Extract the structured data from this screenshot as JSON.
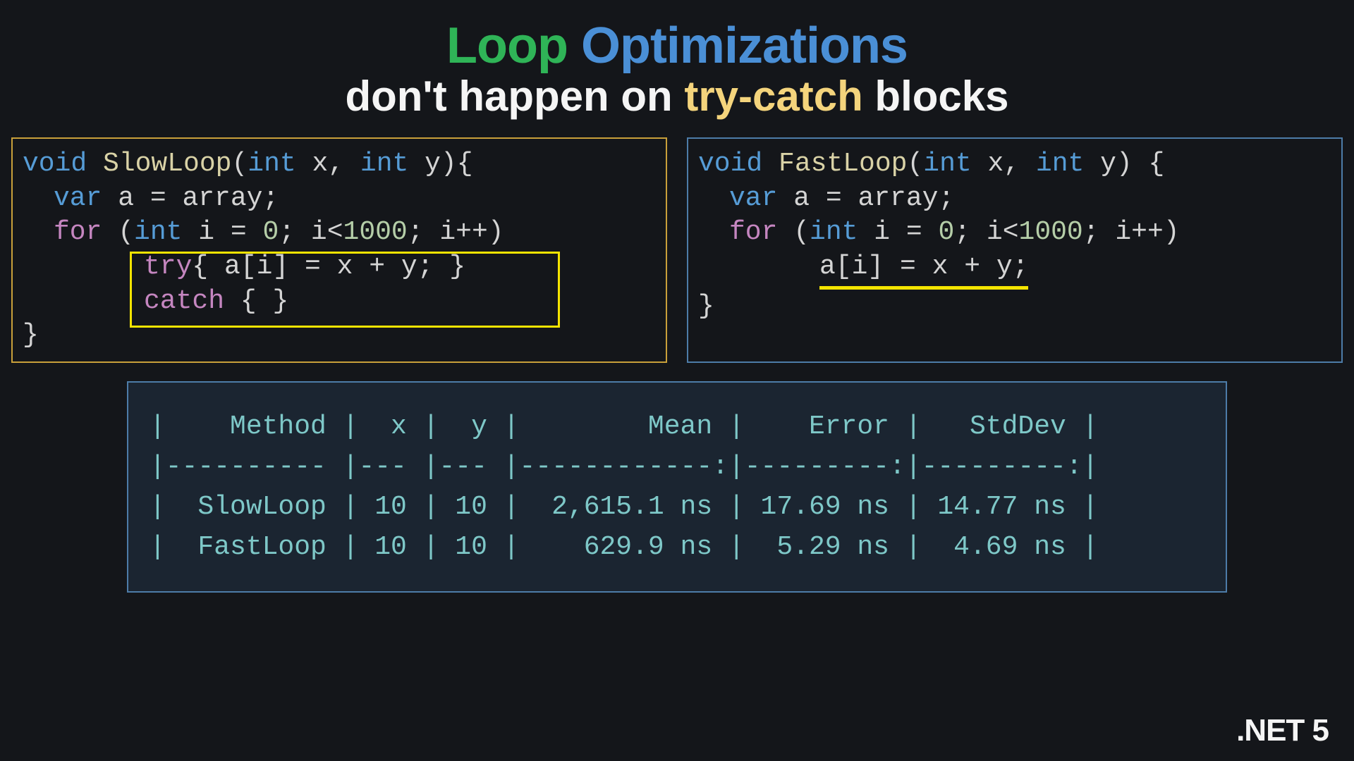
{
  "title": {
    "word1": "Loop",
    "word2": "Optimizations",
    "line2_pre": "don't happen on ",
    "line2_hl": "try-catch",
    "line2_post": " blocks"
  },
  "code_left": {
    "l1_kw": "void",
    "l1_fn": " SlowLoop",
    "l1_rest1": "(",
    "l1_kw2": "int",
    "l1_rest2": " x, ",
    "l1_kw3": "int",
    "l1_rest3": " y){",
    "l2_kw": "var",
    "l2_rest": " a = array;",
    "l3_kw": "for",
    "l3_rest1": " (",
    "l3_kw2": "int",
    "l3_rest2": " i = ",
    "l3_num1": "0",
    "l3_rest3": "; i<",
    "l3_num2": "1000",
    "l3_rest4": "; i++)",
    "l4_try": "try",
    "l4_rest": "{ a[i] = x + y; }",
    "l5_catch": "catch",
    "l5_rest": " { }",
    "l6": "}"
  },
  "code_right": {
    "l1_kw": "void",
    "l1_fn": " FastLoop",
    "l1_rest1": "(",
    "l1_kw2": "int",
    "l1_rest2": " x, ",
    "l1_kw3": "int",
    "l1_rest3": " y) {",
    "l2_kw": "var",
    "l2_rest": " a = array;",
    "l3_kw": "for",
    "l3_rest1": " (",
    "l3_kw2": "int",
    "l3_rest2": " i = ",
    "l3_num1": "0",
    "l3_rest3": "; i<",
    "l3_num2": "1000",
    "l3_rest4": "; i++)",
    "l4": "a[i] = x + y;",
    "l5": "",
    "l6": "}"
  },
  "benchmark": {
    "header": "|    Method |  x |  y |        Mean |    Error |   StdDev |",
    "divider": "|---------- |--- |--- |------------:|---------:|---------:|",
    "row1": "|  SlowLoop | 10 | 10 |  2,615.1 ns | 17.69 ns | 14.77 ns |",
    "row2": "|  FastLoop | 10 | 10 |    629.9 ns |  5.29 ns |  4.69 ns |"
  },
  "chart_data": {
    "type": "table",
    "columns": [
      "Method",
      "x",
      "y",
      "Mean",
      "Error",
      "StdDev"
    ],
    "rows": [
      {
        "Method": "SlowLoop",
        "x": 10,
        "y": 10,
        "Mean": "2,615.1 ns",
        "Error": "17.69 ns",
        "StdDev": "14.77 ns"
      },
      {
        "Method": "FastLoop",
        "x": 10,
        "y": 10,
        "Mean": "629.9 ns",
        "Error": "5.29 ns",
        "StdDev": "4.69 ns"
      }
    ]
  },
  "footer": ".NET 5"
}
